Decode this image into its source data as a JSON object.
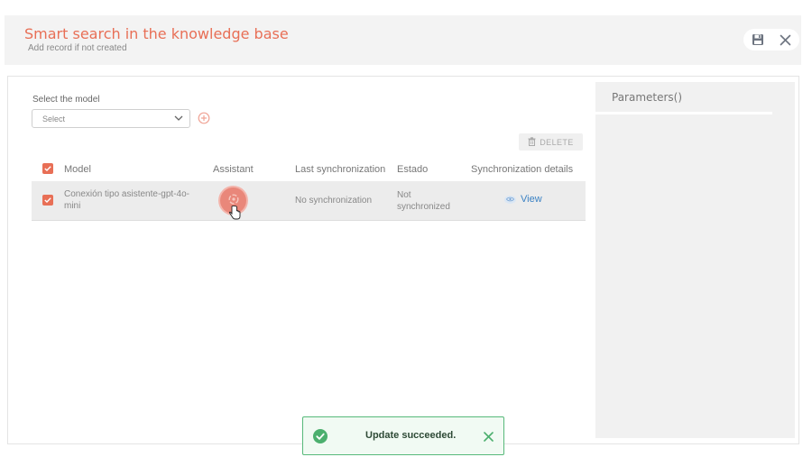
{
  "header": {
    "title": "Smart search in the knowledge base",
    "subtitle": "Add record if not created",
    "icons": [
      "save-icon",
      "close-icon"
    ]
  },
  "form": {
    "model_label": "Select the model",
    "model_placeholder": "Select",
    "delete_label": "DELETE"
  },
  "table": {
    "columns": [
      "Model",
      "Assistant",
      "Last synchronization",
      "Estado",
      "Synchronization details"
    ],
    "rows": [
      {
        "model": "Conexión tipo asistente-gpt-4o-mini",
        "last_sync": "No synchronization",
        "estado": "Not synchronized",
        "details": "View"
      }
    ]
  },
  "parameters": {
    "title": "Parameters()"
  },
  "toast": {
    "message": "Update succeeded."
  },
  "colors": {
    "accent": "#e86f56",
    "link": "#3b82c4",
    "success": "#57b97a"
  }
}
